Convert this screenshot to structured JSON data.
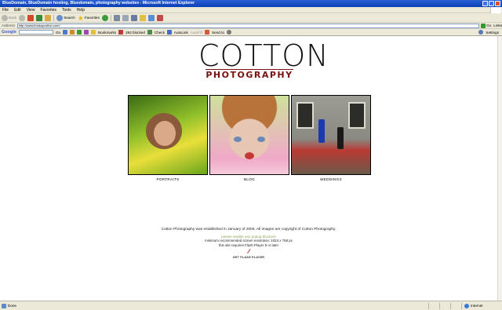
{
  "window": {
    "title": "BlueDomain, BlueDomain hosting, Bluedomain, photography websites - Microsoft Internet Explorer"
  },
  "menu": [
    "File",
    "Edit",
    "View",
    "Favorites",
    "Tools",
    "Help"
  ],
  "toolbar": {
    "back_label": "Back",
    "search_label": "Search",
    "favorites_label": "Favorites"
  },
  "address": {
    "label": "Address",
    "url": "http://www.lindsaycotton.com/",
    "go_label": "Go",
    "links_label": "Links"
  },
  "googlebar": {
    "logo": "Google",
    "go_label": "Go",
    "bookmarks_label": "Bookmarks",
    "blocked_label": "292 blocked",
    "check_label": "Check",
    "autolink_label": "AutoLink",
    "autofill_label": "AutoFill",
    "sendto_label": "Send to",
    "settings_label": "Settings"
  },
  "site": {
    "logo_title": "COTTON",
    "logo_sub": "PHOTOGRAPHY",
    "galleries": [
      {
        "label": "PORTRAITS"
      },
      {
        "label": "BLOG"
      },
      {
        "label": "WEDDINGS"
      }
    ],
    "established": "Cotton Photography was established in January of 2006. All images are copyright of Cotton Photography.",
    "skip": "please enable any popup blockers",
    "resolution": "minimum recommended screen resolution: 1024 x 768 px",
    "flash_req": "this site requires Flash Player 8 or later",
    "get_flash": "GET FLASH PLAYER"
  },
  "status": {
    "text": "Done",
    "zone": "Internet"
  }
}
